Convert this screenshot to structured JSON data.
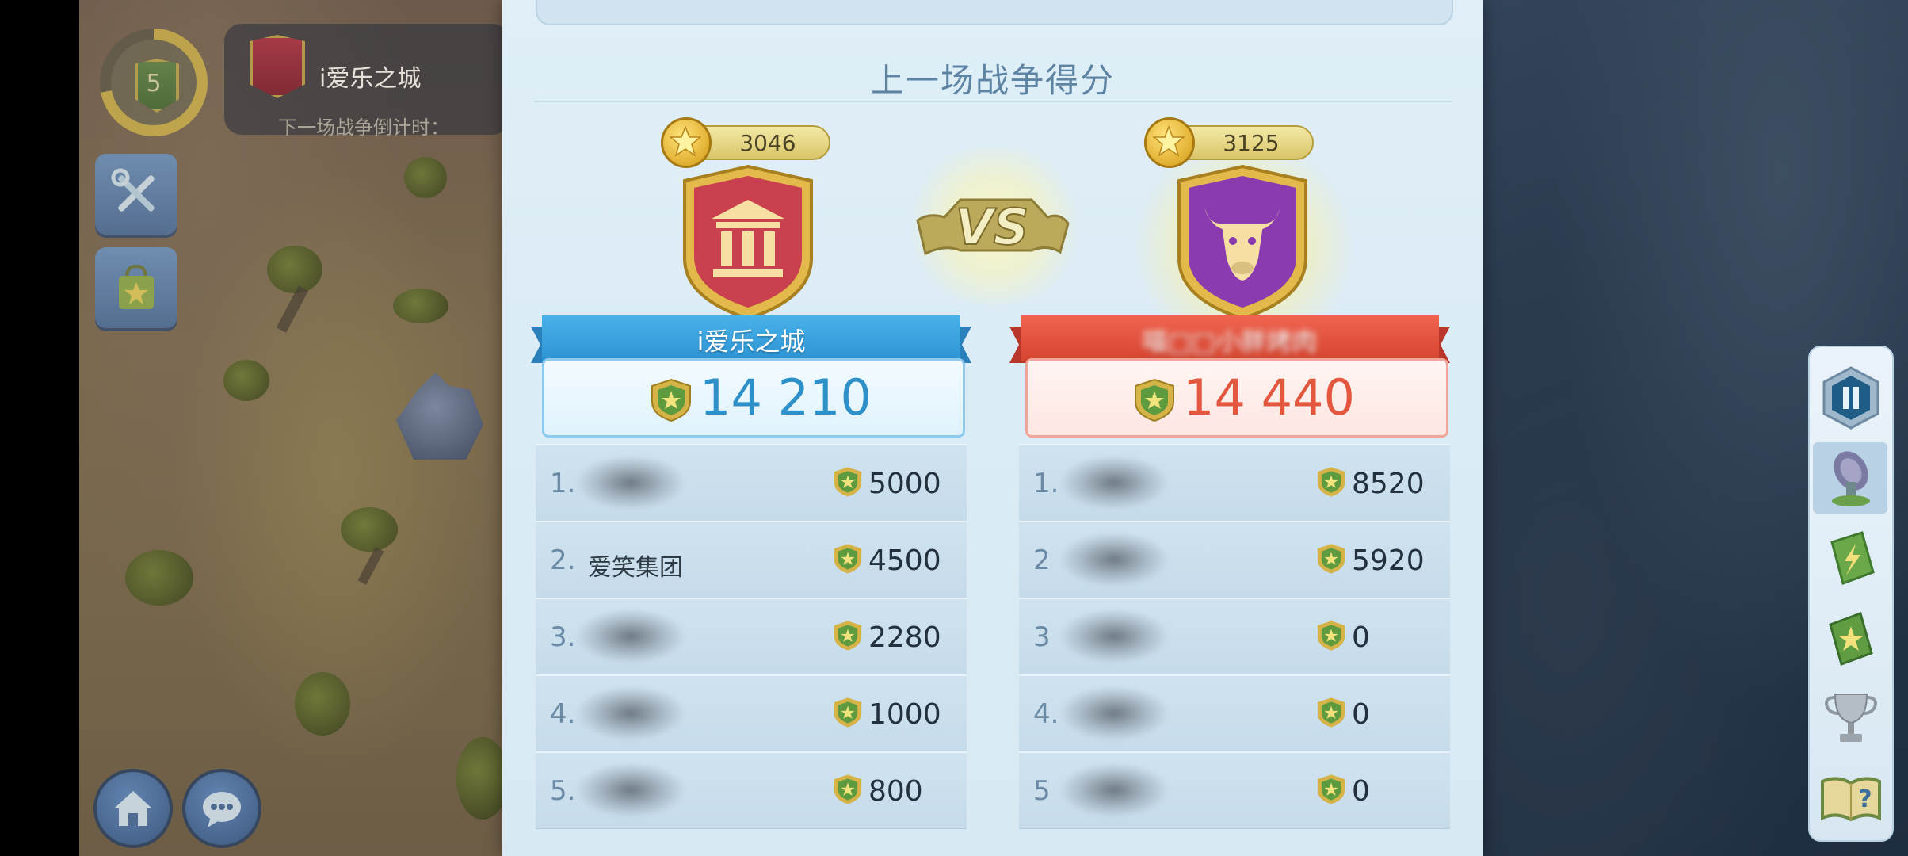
{
  "hud": {
    "player_level": "5",
    "city_name": "i爱乐之城",
    "countdown_label": "下一场战争倒计时："
  },
  "panel": {
    "title": "上一场战争得分"
  },
  "left_team": {
    "name": "i爱乐之城",
    "rating": "3046",
    "total": "14 210",
    "color": "#3fa6e0",
    "emblem": "bank-icon",
    "members": [
      {
        "rank": "1.",
        "name": "",
        "points": "5000"
      },
      {
        "rank": "2.",
        "name": "爱笑集团",
        "points": "4500"
      },
      {
        "rank": "3.",
        "name": "",
        "points": "2280"
      },
      {
        "rank": "4.",
        "name": "",
        "points": "1000"
      },
      {
        "rank": "5.",
        "name": "",
        "points": "800"
      }
    ]
  },
  "vs_label": "VS",
  "right_team": {
    "name": "喵□□小胖烤肉",
    "rating": "3125",
    "total": "14 440",
    "color": "#e4503c",
    "emblem": "bull-icon",
    "members": [
      {
        "rank": "1.",
        "name": "",
        "points": "8520"
      },
      {
        "rank": "2",
        "name": "",
        "points": "5920"
      },
      {
        "rank": "3",
        "name": "",
        "points": "0"
      },
      {
        "rank": "4.",
        "name": "",
        "points": "0"
      },
      {
        "rank": "5",
        "name": "",
        "points": "0"
      }
    ]
  },
  "toolbar": {
    "items": [
      "pause-icon",
      "radar-icon",
      "lightning-card-icon",
      "star-card-icon",
      "trophy-icon",
      "help-book-icon"
    ]
  },
  "side_buttons": [
    "tools-icon",
    "shop-bag-icon"
  ],
  "bottom_buttons": [
    "home-icon",
    "chat-icon"
  ]
}
